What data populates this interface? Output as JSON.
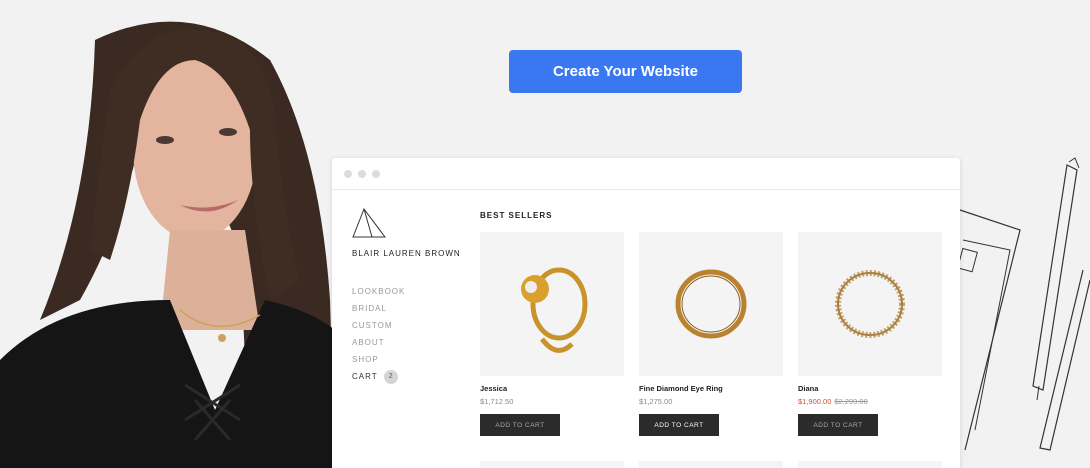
{
  "cta_label": "Create Your Website",
  "store": {
    "brand": "BLAIR LAUREN BROWN",
    "nav": [
      "LOOKBOOK",
      "BRIDAL",
      "CUSTOM",
      "ABOUT",
      "SHOP",
      "CART"
    ],
    "cart_count": "2",
    "section_title": "BEST SELLERS",
    "products": [
      {
        "name": "Jessica",
        "price": "$1,712.50",
        "button": "ADD TO CART"
      },
      {
        "name": "Fine Diamond Eye Ring",
        "price": "$1,275.00",
        "button": "ADD TO CART"
      },
      {
        "name": "Diana",
        "sale_price": "$1,900.00",
        "old_price": "$2,299.00",
        "button": "ADD TO CART"
      }
    ]
  },
  "colors": {
    "accent": "#3a78f2",
    "sale": "#d24b3b",
    "button_dark": "#2b2b2b"
  }
}
